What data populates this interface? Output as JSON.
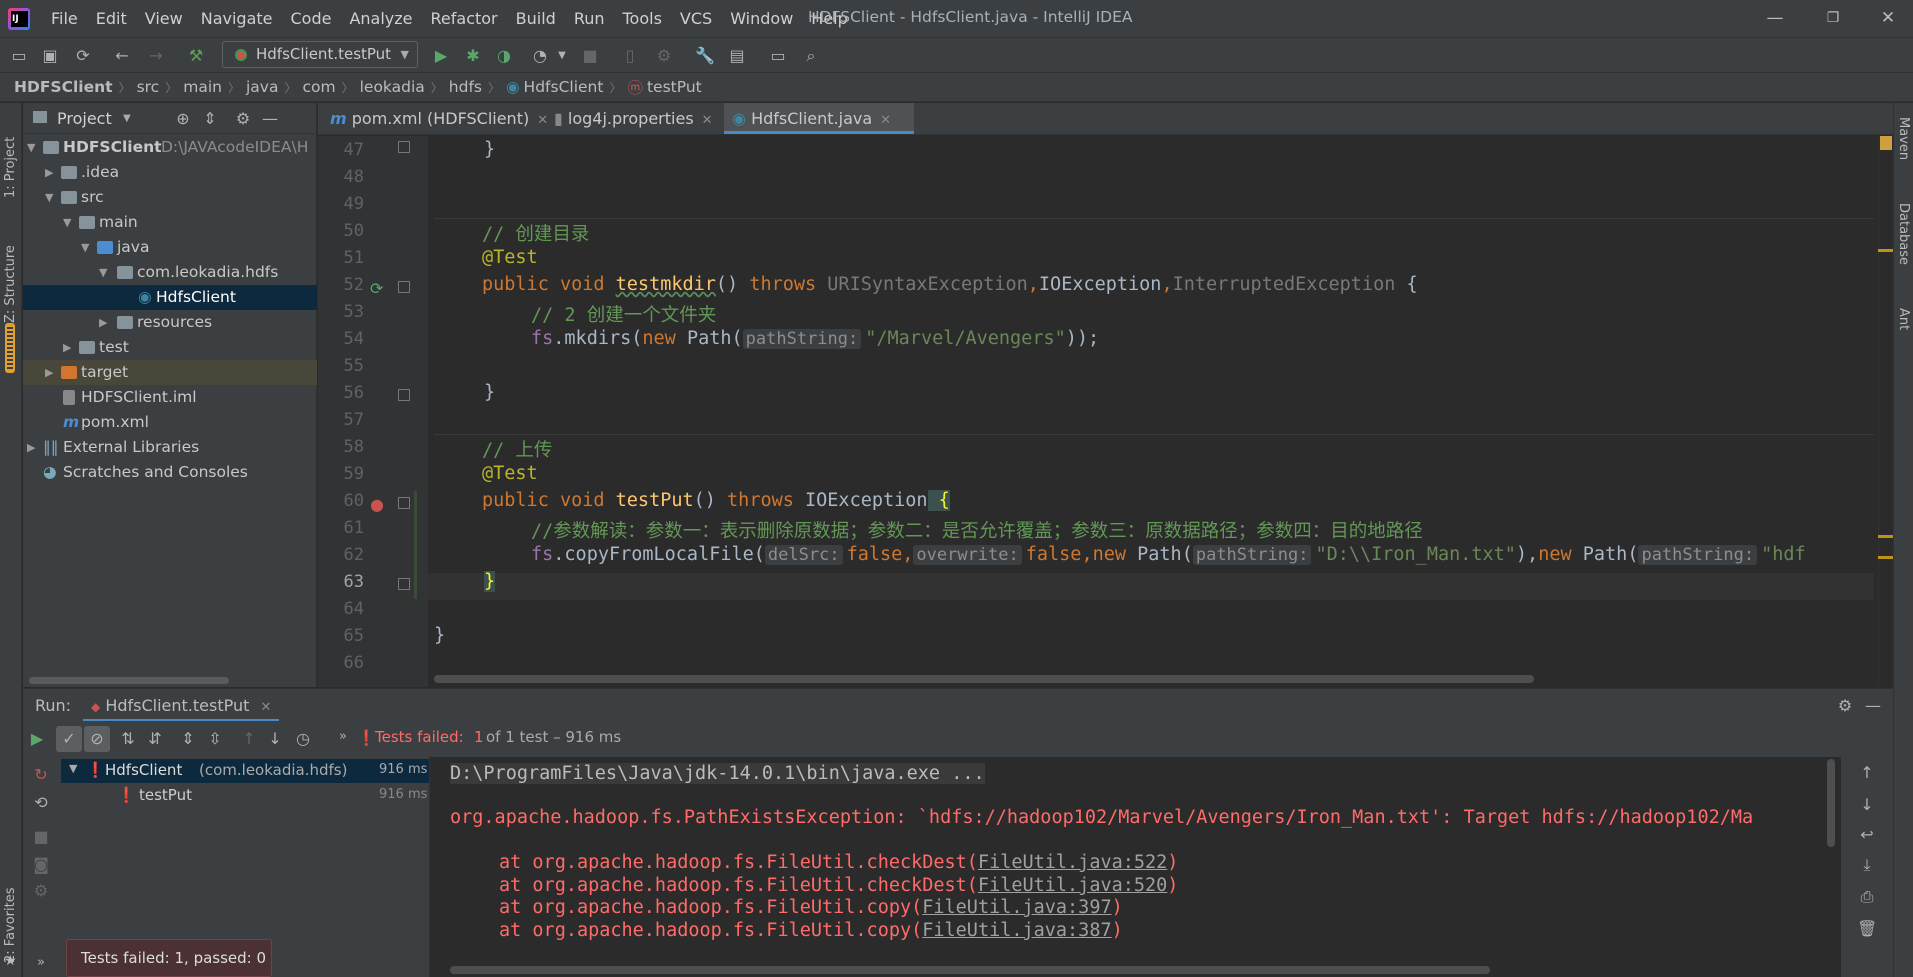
{
  "window": {
    "title": "HDFSClient - HdfsClient.java - IntelliJ IDEA",
    "menu": [
      "File",
      "Edit",
      "View",
      "Navigate",
      "Code",
      "Analyze",
      "Refactor",
      "Build",
      "Run",
      "Tools",
      "VCS",
      "Window",
      "Help"
    ]
  },
  "toolbar": {
    "run_config": "HdfsClient.testPut"
  },
  "breadcrumb": [
    "HDFSClient",
    "src",
    "main",
    "java",
    "com",
    "leokadia",
    "hdfs",
    "HdfsClient",
    "testPut"
  ],
  "left_stripe": {
    "project": "1: Project",
    "structure": "Z: Structure",
    "favorites": "2: Favorites"
  },
  "right_stripe": {
    "maven": "Maven",
    "database": "Database",
    "ant": "Ant"
  },
  "project_panel": {
    "title": "Project",
    "tree": [
      {
        "label": "HDFSClient",
        "extra": "D:\\JAVAcodeIDEA\\H"
      },
      {
        "label": ".idea"
      },
      {
        "label": "src"
      },
      {
        "label": "main"
      },
      {
        "label": "java"
      },
      {
        "label": "com.leokadia.hdfs"
      },
      {
        "label": "HdfsClient"
      },
      {
        "label": "resources"
      },
      {
        "label": "test"
      },
      {
        "label": "target"
      },
      {
        "label": "HDFSClient.iml"
      },
      {
        "label": "pom.xml"
      },
      {
        "label": "External Libraries"
      },
      {
        "label": "Scratches and Consoles"
      }
    ]
  },
  "tabs": [
    "pom.xml (HDFSClient)",
    "log4j.properties",
    "HdfsClient.java"
  ],
  "editor": {
    "line_numbers": [
      "47",
      "48",
      "49",
      "50",
      "51",
      "52",
      "53",
      "54",
      "55",
      "56",
      "57",
      "58",
      "59",
      "60",
      "61",
      "62",
      "63",
      "64",
      "65",
      "66"
    ],
    "t47": "}",
    "c50": "// 创建目录",
    "a51": "@Test",
    "k52a": "public void ",
    "f52": "testmkdir",
    "p52": "() ",
    "k52b": "throws ",
    "e52a": "URISyntaxException",
    "e52b": "IOException",
    "e52c": "InterruptedException",
    "t52": " {",
    "c53": "// 2 创建一个文件夹",
    "v54": "fs",
    "t54a": ".mkdirs(",
    "k54": "new ",
    "t54b": "Path(",
    "h54": "pathString:",
    "s54": "\"/Marvel/Avengers\"",
    "t54c": "));",
    "t56": "}",
    "c58": "// 上传",
    "a59": "@Test",
    "k60a": "public void ",
    "f60": "testPut",
    "p60": "() ",
    "k60b": "throws ",
    "e60": "IOException",
    "t60": " {",
    "c61": "//参数解读：参数一：表示删除原数据；参数二：是否允许覆盖；参数三：原数据路径；参数四：目的地路径",
    "v62": "fs",
    "t62a": ".copyFromLocalFile(",
    "h62a": "delSrc:",
    "k62a": "false,",
    "h62b": "overwrite:",
    "k62b": "false,new ",
    "t62b": "Path(",
    "h62c": "pathString:",
    "s62a": "\"D:\\\\Iron_Man.txt\"",
    "t62c": "),",
    "k62c": "new ",
    "t62d": "Path(",
    "h62d": "pathString:",
    "s62b": "\"hdf",
    "t63": "}",
    "t65": "}"
  },
  "run": {
    "label": "Run:",
    "tab": "HdfsClient.testPut",
    "status": "Tests failed:",
    "status_count": "1",
    "status_rest": "of 1 test – 916 ms",
    "tests": [
      {
        "name": "HdfsClient",
        "pkg": "(com.leokadia.hdfs)",
        "time": "916 ms"
      },
      {
        "name": "testPut",
        "time": "916 ms"
      }
    ],
    "console": {
      "cmd": "D:\\ProgramFiles\\Java\\jdk-14.0.1\\bin\\java.exe ...",
      "exception": "org.apache.hadoop.fs.PathExistsException: `hdfs://hadoop102/Marvel/Avengers/Iron_Man.txt': Target hdfs://hadoop102/Ma",
      "frames": [
        {
          "at": "at org.apache.hadoop.fs.FileUtil.checkDest(",
          "link": "FileUtil.java:522",
          "end": ")"
        },
        {
          "at": "at org.apache.hadoop.fs.FileUtil.checkDest(",
          "link": "FileUtil.java:520",
          "end": ")"
        },
        {
          "at": "at org.apache.hadoop.fs.FileUtil.copy(",
          "link": "FileUtil.java:397",
          "end": ")"
        },
        {
          "at": "at org.apache.hadoop.fs.FileUtil.copy(",
          "link": "FileUtil.java:387",
          "end": ")"
        }
      ]
    },
    "toast": "Tests failed: 1, passed: 0"
  }
}
